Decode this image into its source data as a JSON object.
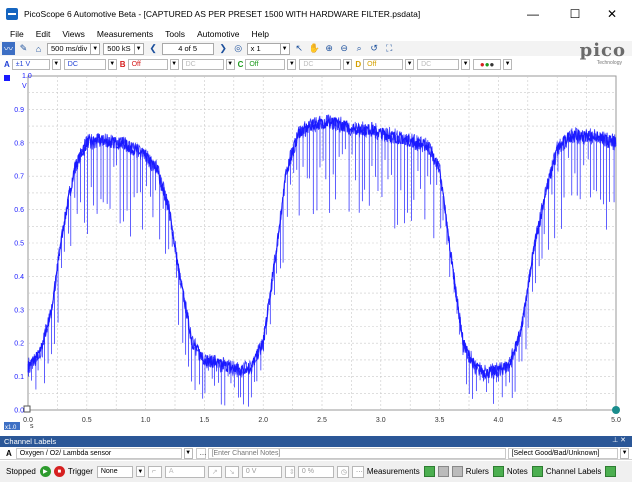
{
  "window": {
    "title": "PicoScope 6 Automotive Beta - [CAPTURED AS PER PRESET 1500 WITH  HARDWARE FILTER.psdata]",
    "minimize": "—",
    "maximize": "☐",
    "close": "✕"
  },
  "menu": [
    "File",
    "Edit",
    "Views",
    "Measurements",
    "Tools",
    "Automotive",
    "Help"
  ],
  "toolbar": {
    "timebase": "500 ms/div",
    "samples": "500 kS",
    "buffer": "4 of 5",
    "zoom": "x 1"
  },
  "logo": {
    "main": "pico",
    "sub": "Technology"
  },
  "channels": [
    {
      "letter": "A",
      "range": "±1 V",
      "coupling": "DC",
      "color": "#1f3fd6"
    },
    {
      "letter": "B",
      "range": "Off",
      "coupling": "DC",
      "color": "#d62020"
    },
    {
      "letter": "C",
      "range": "Off",
      "coupling": "DC",
      "color": "#1e9a1e"
    },
    {
      "letter": "D",
      "range": "Off",
      "coupling": "DC",
      "color": "#d4a000"
    }
  ],
  "plot": {
    "y_unit": "V",
    "y_ticks": [
      "1.0",
      "0.9",
      "0.8",
      "0.7",
      "0.6",
      "0.5",
      "0.4",
      "0.3",
      "0.2",
      "0.1",
      "0.0"
    ],
    "x_unit": "s",
    "x_ticks": [
      "0.0",
      "0.5",
      "1.0",
      "1.5",
      "2.0",
      "2.5",
      "3.0",
      "3.5",
      "4.0",
      "4.5",
      "5.0"
    ],
    "zoom_badge": "x1.0",
    "trace_color": "#1a1aff"
  },
  "chart_data": {
    "type": "line",
    "xlabel": "s",
    "ylabel": "V",
    "xlim": [
      0,
      5
    ],
    "ylim": [
      0,
      1
    ],
    "grid": true,
    "series": [
      {
        "x": [
          0.0,
          0.1,
          0.2,
          0.3,
          0.4,
          0.5,
          0.6,
          0.7,
          0.8,
          0.9,
          1.0,
          1.1,
          1.2,
          1.3,
          1.4,
          1.5,
          1.6,
          1.7,
          1.8,
          1.9,
          2.0,
          2.1,
          2.2,
          2.3,
          2.4,
          2.5,
          2.6,
          2.7,
          2.8,
          2.9,
          3.0,
          3.1,
          3.2,
          3.3,
          3.4,
          3.5,
          3.6,
          3.7,
          3.8,
          3.9,
          4.0,
          4.1,
          4.2,
          4.3,
          4.4,
          4.5,
          4.6,
          4.7,
          4.8,
          4.9,
          5.0
        ],
        "values": [
          0.13,
          0.17,
          0.3,
          0.55,
          0.73,
          0.8,
          0.81,
          0.8,
          0.8,
          0.78,
          0.76,
          0.72,
          0.6,
          0.38,
          0.2,
          0.15,
          0.14,
          0.13,
          0.12,
          0.13,
          0.2,
          0.45,
          0.72,
          0.83,
          0.85,
          0.86,
          0.86,
          0.85,
          0.84,
          0.84,
          0.83,
          0.82,
          0.81,
          0.8,
          0.79,
          0.72,
          0.45,
          0.2,
          0.13,
          0.11,
          0.12,
          0.14,
          0.25,
          0.48,
          0.65,
          0.78,
          0.82,
          0.82,
          0.82,
          0.81,
          0.8
        ]
      }
    ]
  },
  "channel_labels": {
    "header": "Channel Labels",
    "channel": "A",
    "label": "Oxygen / O2/ Lambda sensor",
    "notes_placeholder": "[Enter Channel Notes]",
    "grade": "[Select Good/Bad/Unknown]"
  },
  "status": {
    "state": "Stopped",
    "trigger_label": "Trigger",
    "trigger_value": "None",
    "trigger_channel": "A",
    "trigger_level": "0 V",
    "trigger_pct": "0 %",
    "measurements": "Measurements",
    "rulers": "Rulers",
    "notes": "Notes",
    "channel_labels": "Channel Labels"
  }
}
